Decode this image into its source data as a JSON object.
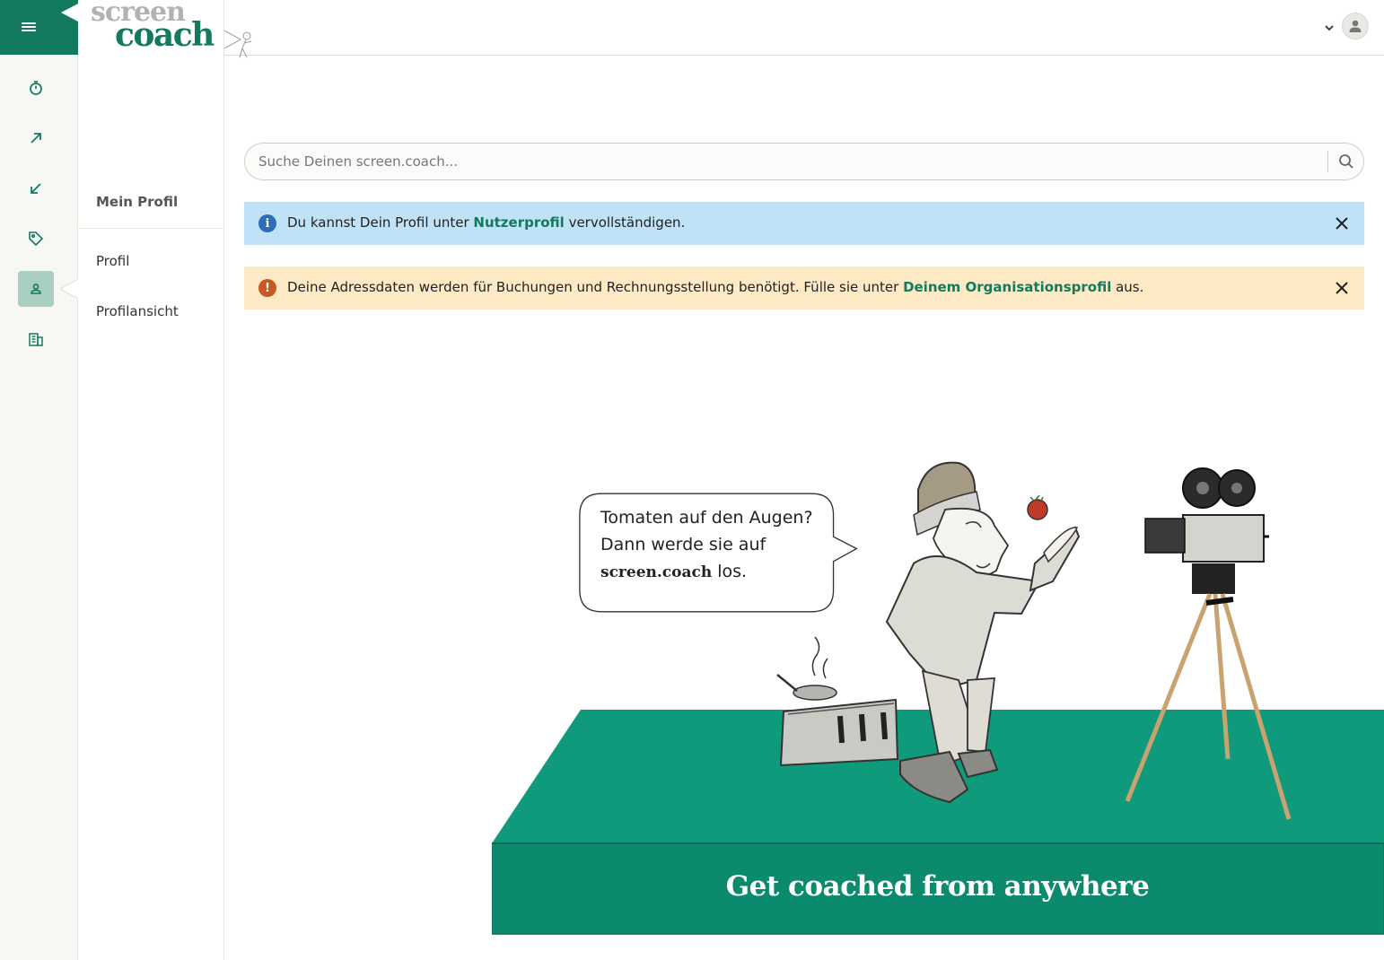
{
  "brand": {
    "logo_top": "screen",
    "logo_bottom": "coach"
  },
  "rail": {
    "items": [
      {
        "name": "timer",
        "active": false
      },
      {
        "name": "arrow-up-right",
        "active": false
      },
      {
        "name": "arrow-down-left",
        "active": false
      },
      {
        "name": "tag",
        "active": false
      },
      {
        "name": "user",
        "active": true
      },
      {
        "name": "building",
        "active": false
      }
    ]
  },
  "subnav": {
    "section_title": "Mein Profil",
    "items": [
      "Profil",
      "Profilansicht"
    ]
  },
  "search": {
    "placeholder": "Suche Deinen screen.coach..."
  },
  "alerts": {
    "info": {
      "before": "Du kannst Dein Profil unter ",
      "link": "Nutzerprofil",
      "after": " vervollständigen."
    },
    "warning": {
      "before": "Deine Adressdaten werden für Buchungen und Rechnungsstellung benötigt. Fülle sie unter ",
      "link": "Deinem Organisationsprofil",
      "after": " aus."
    }
  },
  "illustration": {
    "bubble_line1": "Tomaten auf den Augen?",
    "bubble_line2": "Dann werde sie auf",
    "bubble_brand": "screen.coach",
    "bubble_after": " los.",
    "banner": "Get coached from anywhere"
  },
  "colors": {
    "brand_green": "#137a5f",
    "stage_green": "#0f9a7c",
    "info_bg": "#bfe2f7",
    "warning_bg": "#fde9c4"
  }
}
